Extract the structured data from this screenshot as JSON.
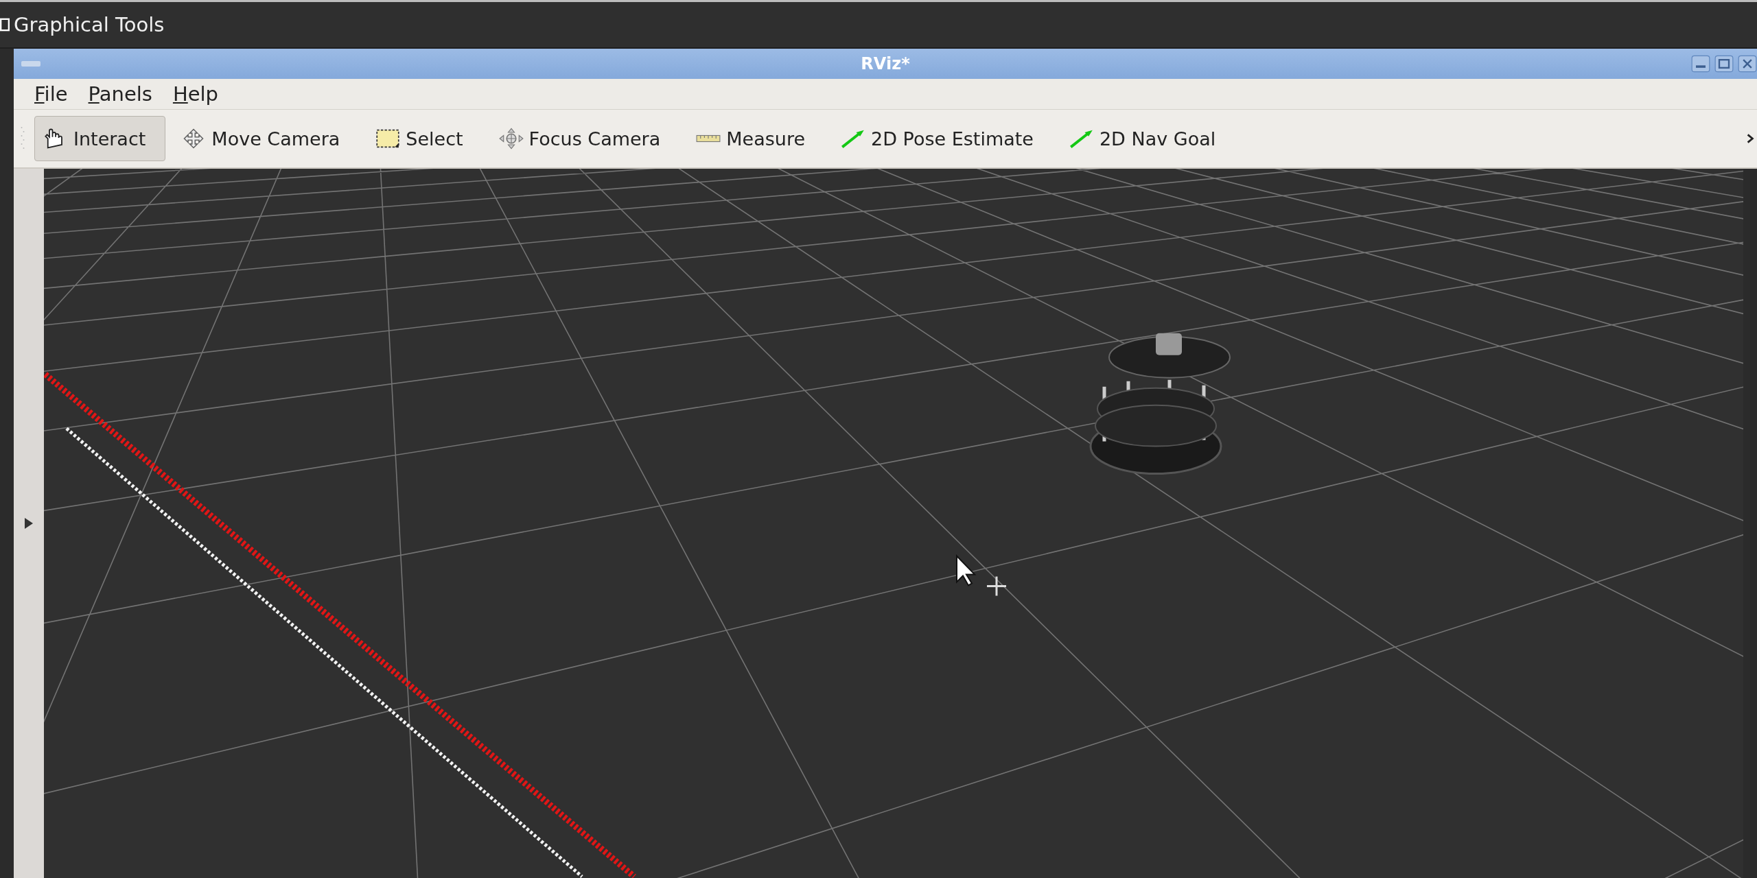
{
  "desktop_bar": {
    "title": "Graphical Tools"
  },
  "window": {
    "title": "RViz*"
  },
  "menu": [
    "File",
    "Panels",
    "Help"
  ],
  "toolbar": [
    {
      "label": "Interact",
      "selected": true
    },
    {
      "label": "Move Camera",
      "selected": false
    },
    {
      "label": "Select",
      "selected": false
    },
    {
      "label": "Focus Camera",
      "selected": false
    },
    {
      "label": "Measure",
      "selected": false
    },
    {
      "label": "2D Pose Estimate",
      "selected": false
    },
    {
      "label": "2D Nav Goal",
      "selected": false
    }
  ],
  "side_panel": {
    "expanded": false
  }
}
